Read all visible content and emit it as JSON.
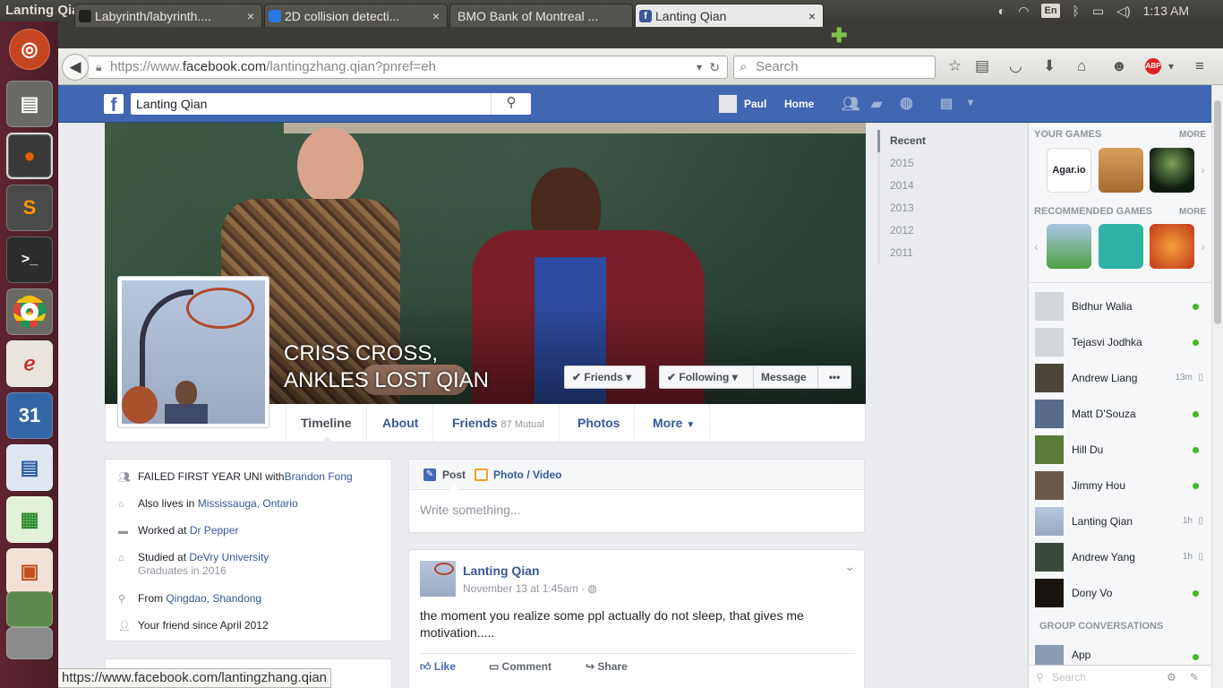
{
  "window": {
    "title": "Lanting Qian - Mozilla Firefox"
  },
  "tray": {
    "lang": "En",
    "time": "1:13 AM"
  },
  "tabs": [
    {
      "label": "Labyrinth/labyrinth....",
      "color": "#222222"
    },
    {
      "label": "2D collision detecti...",
      "color": "#2a7ae2"
    },
    {
      "label": "BMO Bank of Montreal ...",
      "color": "#0079c1"
    },
    {
      "label": "Lanting Qian",
      "color": "#3b5998"
    }
  ],
  "close_glyph": "×",
  "newtab_glyph": "✚",
  "address": {
    "prefix": "https://www.",
    "domain": "facebook.com",
    "path": "/lantingzhang.qian?pnref=eh"
  },
  "search": {
    "placeholder": "Search"
  },
  "fb": {
    "search_value": "Lanting Qian",
    "user": "Paul",
    "home": "Home"
  },
  "profile": {
    "name_line1": "CRISS CROSS,",
    "name_line2": "ANKLES LOST QIAN",
    "friends_btn": "Friends",
    "following_btn": "Following",
    "message_btn": "Message",
    "more_btn": "•••"
  },
  "timeline_nav": [
    {
      "label": "Timeline"
    },
    {
      "label": "About"
    },
    {
      "label": "Friends",
      "extra": "87 Mutual"
    },
    {
      "label": "Photos"
    },
    {
      "label": "More"
    }
  ],
  "intro": {
    "r1_pre": "FAILED FIRST YEAR UNI with",
    "r1_link": "Brandon Fong",
    "r2_pre": "Also lives in ",
    "r2_link": "Mississauga, Ontario",
    "r3_pre": "Worked at ",
    "r3_link": "Dr Pepper",
    "r4_pre": "Studied at ",
    "r4_link": "DeVry University",
    "r4_sub": "Graduates in 2016",
    "r5_pre": "From ",
    "r5_link": "Qingdao, Shandong",
    "r6": "Your friend since April 2012"
  },
  "composer": {
    "post_tab": "Post",
    "photo_tab": "Photo",
    "video_tab": "Video",
    "slash": " / ",
    "placeholder": "Write something..."
  },
  "post": {
    "author": "Lanting Qian",
    "date": "November 13 at 1:45am · ",
    "text": "the moment you realize some ppl actually do not sleep, that gives me motivation.....",
    "like": "Like",
    "comment": "Comment",
    "share": "Share"
  },
  "years": [
    "Recent",
    "2015",
    "2014",
    "2013",
    "2012",
    "2011"
  ],
  "sidebar": {
    "your_games": "YOUR GAMES",
    "rec_games": "RECOMMENDED GAMES",
    "more": "MORE",
    "agar_label": "Agar.io",
    "group_conv": "GROUP CONVERSATIONS",
    "search_placeholder": "Search",
    "contacts": [
      {
        "name": "Bidhur Walia",
        "status": "",
        "online": true
      },
      {
        "name": "Tejasvi Jodhka",
        "status": "",
        "online": true
      },
      {
        "name": "Andrew Liang",
        "status": "13m",
        "online": false
      },
      {
        "name": "Matt D'Souza",
        "status": "",
        "online": true
      },
      {
        "name": "Hill Du",
        "status": "",
        "online": true
      },
      {
        "name": "Jimmy Hou",
        "status": "",
        "online": true
      },
      {
        "name": "Lanting Qian",
        "status": "1h",
        "online": false
      },
      {
        "name": "Andrew Yang",
        "status": "1h",
        "online": false
      },
      {
        "name": "Dony Vo",
        "status": "",
        "online": true
      }
    ],
    "group": {
      "name": "App"
    }
  },
  "status_url": "https://www.facebook.com/lantingzhang.qian"
}
